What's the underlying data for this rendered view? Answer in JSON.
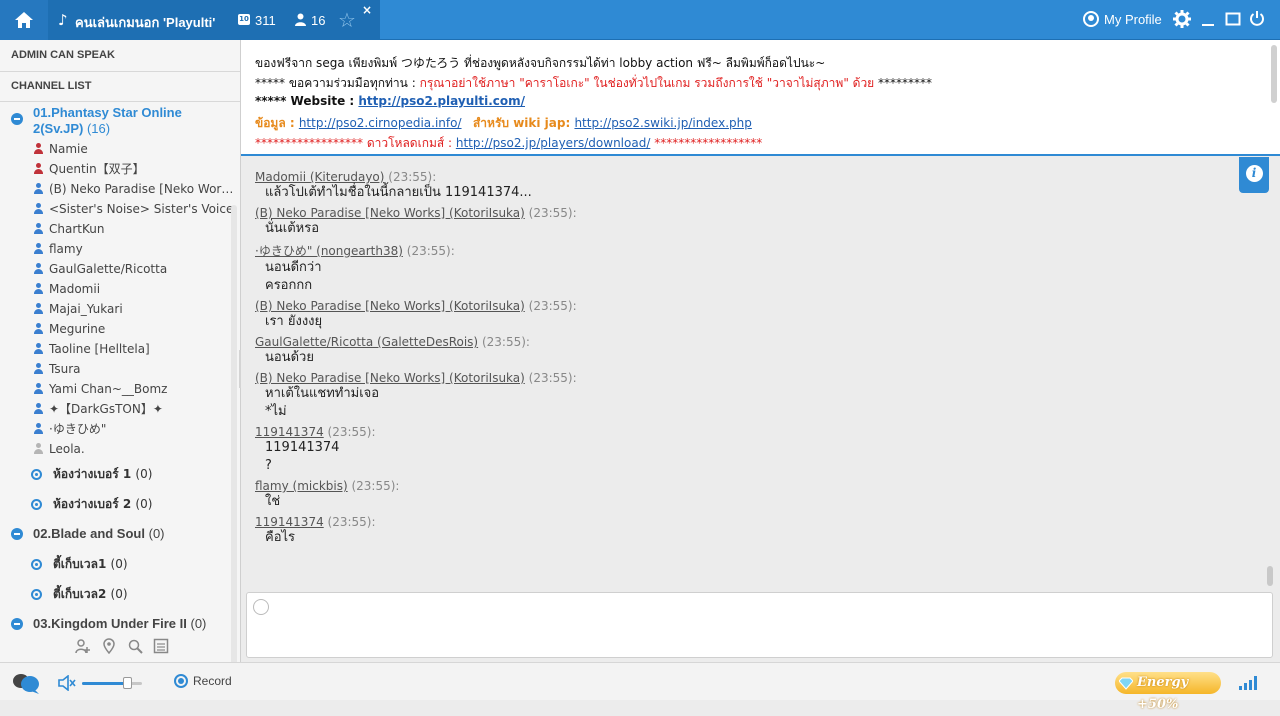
{
  "topbar": {
    "room_title": "คนเล่นเกมนอก 'Playulti'",
    "room_count": "311",
    "room_count_badge": "10",
    "user_count": "16",
    "profile_label": "My Profile"
  },
  "sidebar": {
    "admin_header": "ADMIN CAN SPEAK",
    "channel_header": "CHANNEL LIST",
    "channel1": {
      "name": "01.Phantasy Star Online 2(Sv.JP)",
      "count": "(16)"
    },
    "users": [
      {
        "name": "Namie",
        "color": "#c0323a"
      },
      {
        "name": "Quentin【双子】",
        "color": "#c0323a"
      },
      {
        "name": "(B) Neko Paradise [Neko Wor…",
        "color": "#3a7fd0"
      },
      {
        "name": "<Sister's Noise> Sister's Voice",
        "color": "#3a7fd0"
      },
      {
        "name": "ChartKun",
        "color": "#3a7fd0"
      },
      {
        "name": "flamy",
        "color": "#3a7fd0"
      },
      {
        "name": "GaulGalette/Ricotta",
        "color": "#3a7fd0"
      },
      {
        "name": "Madomii",
        "color": "#3a7fd0"
      },
      {
        "name": "Majai_Yukari",
        "color": "#3a7fd0"
      },
      {
        "name": "Megurine",
        "color": "#3a7fd0"
      },
      {
        "name": "Taoline [Helltela]",
        "color": "#3a7fd0"
      },
      {
        "name": "Tsura",
        "color": "#3a7fd0"
      },
      {
        "name": "Yami Chan~__Bomz",
        "color": "#3a7fd0"
      },
      {
        "name": "✦【DarkGsTON】✦",
        "color": "#3a7fd0"
      },
      {
        "name": "·ゆきひめ\"",
        "color": "#3a7fd0"
      },
      {
        "name": "Leola.",
        "color": "#b5b5b5"
      }
    ],
    "sub1": [
      {
        "name": "ห้องว่างเบอร์ 1",
        "count": "(0)"
      },
      {
        "name": "ห้องว่างเบอร์ 2",
        "count": "(0)"
      }
    ],
    "channel2": {
      "name": "02.Blade and Soul",
      "count": "(0)"
    },
    "sub2": [
      {
        "name": "ตี้เก็บเวล1",
        "count": "(0)"
      },
      {
        "name": "ตี้เก็บเวล2",
        "count": "(0)"
      }
    ],
    "channel3": {
      "name": "03.Kingdom Under Fire II",
      "count": "(0)"
    }
  },
  "notice": {
    "line1": "ของฟรีจาก sega เพียงพิมพ์ つゆたろう ที่ช่องพูดหลังจบกิจกรรมได้ท่า lobby action ฟรี~ ลืมพิมพ์ก็อดไปนะ~",
    "line2_a": "***** ขอความร่วมมือทุกท่าน : ",
    "line2_b": "กรุณาอย่าใช้ภาษา \"คาราโอเกะ\" ในช่องทั่วไปในเกม รวมถึงการใช้ \"วาจาไม่สุภาพ\" ด้วย",
    "line2_c": " *********",
    "line3_label": "***** Website : ",
    "line3_link": "http://pso2.playulti.com/",
    "line4_label": "ข้อมูล : ",
    "line4_link1": "http://pso2.cirnopedia.info/",
    "line4_mid": "สำหรับ wiki jap: ",
    "line4_link2": "http://pso2.swiki.jp/index.php",
    "line5_a": "****************** ดาวโหลดเกมส์ : ",
    "line5_link": "http://pso2.jp/players/download/",
    "line5_b": " ******************"
  },
  "messages": [
    {
      "name": "Madomii (Kiterudayo)",
      "time": "(23:55):",
      "lines": [
        "แล้วโปเต้ทำไมชื่อในนี้กลายเป็น 119141374..."
      ]
    },
    {
      "name": "(B) Neko Paradise [Neko Works] (KotoriIsuka)",
      "time": "(23:55):",
      "lines": [
        "นั่นเต้หรอ"
      ]
    },
    {
      "name": "·ゆきひめ\" (nongearth38)",
      "time": "(23:55):",
      "lines": [
        "นอนดีกว่า",
        "ครอกกก"
      ]
    },
    {
      "name": "(B) Neko Paradise [Neko Works] (KotoriIsuka)",
      "time": "(23:55):",
      "lines": [
        "เรา ยังงงยุ"
      ]
    },
    {
      "name": "GaulGalette/Ricotta (GaletteDesRois)",
      "time": "(23:55):",
      "lines": [
        "นอนด้วย"
      ]
    },
    {
      "name": "(B) Neko Paradise [Neko Works] (KotoriIsuka)",
      "time": "(23:55):",
      "lines": [
        "หาเต้ในแชททำม่เจอ",
        "*ไม่"
      ]
    },
    {
      "name": "119141374",
      "time": "(23:55):",
      "lines": [
        "119141374",
        "?"
      ]
    },
    {
      "name": "flamy (mickbis)",
      "time": "(23:55):",
      "lines": [
        "ใช่"
      ]
    },
    {
      "name": "119141374",
      "time": "(23:55):",
      "lines": [
        "คือไร"
      ]
    }
  ],
  "bottombar": {
    "record_label": "Record",
    "energy_label": "Energy +50%",
    "volume_percent": 75
  }
}
